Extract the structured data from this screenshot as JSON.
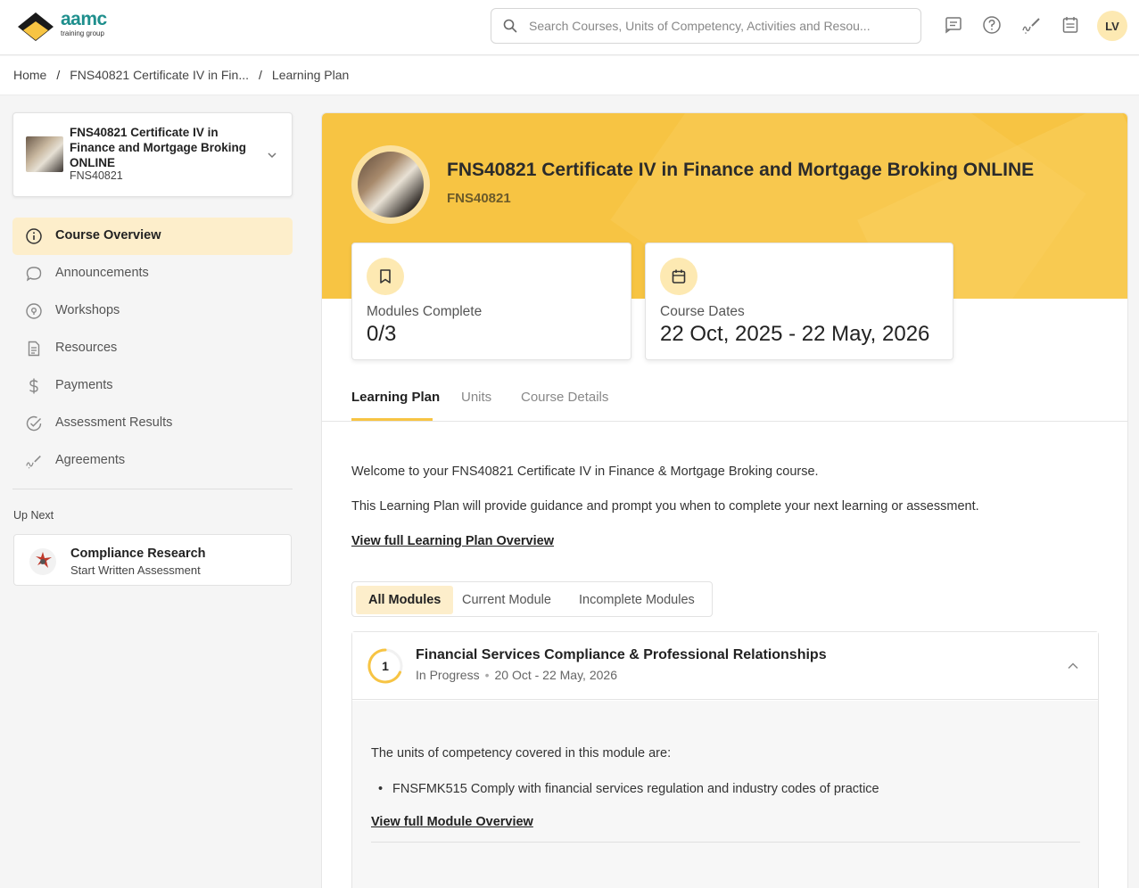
{
  "brand": {
    "name": "aamc",
    "tagline": "training group"
  },
  "search": {
    "placeholder": "Search Courses, Units of Competency, Activities and Resou..."
  },
  "header_icons": [
    "messages-icon",
    "help-icon",
    "agreements-icon",
    "calendar-icon"
  ],
  "user": {
    "initials": "LV"
  },
  "breadcrumb": {
    "home": "Home",
    "course": "FNS40821 Certificate IV in Fin...",
    "current": "Learning Plan"
  },
  "course_selector": {
    "title": "FNS40821 Certificate IV in Finance and Mortgage Broking ONLINE",
    "code": "FNS40821"
  },
  "sidebar": {
    "items": [
      {
        "label": "Course Overview",
        "icon": "info-icon",
        "active": true
      },
      {
        "label": "Announcements",
        "icon": "chat-bubble-icon",
        "active": false
      },
      {
        "label": "Workshops",
        "icon": "location-pin-icon",
        "active": false
      },
      {
        "label": "Resources",
        "icon": "document-icon",
        "active": false
      },
      {
        "label": "Payments",
        "icon": "dollar-icon",
        "active": false
      },
      {
        "label": "Assessment Results",
        "icon": "check-circle-icon",
        "active": false
      },
      {
        "label": "Agreements",
        "icon": "signature-icon",
        "active": false
      }
    ]
  },
  "up_next": {
    "heading": "Up Next",
    "title": "Compliance Research",
    "subtitle": "Start Written Assessment"
  },
  "hero": {
    "title": "FNS40821 Certificate IV in Finance and Mortgage Broking ONLINE",
    "code": "FNS40821",
    "color": "#f7c443"
  },
  "stats": {
    "modules": {
      "label": "Modules Complete",
      "value": "0/3"
    },
    "dates": {
      "label": "Course Dates",
      "value": "22 Oct, 2025 - 22 May, 2026"
    }
  },
  "tabs": [
    "Learning Plan",
    "Units",
    "Course Details"
  ],
  "content": {
    "welcome": "Welcome to your FNS40821 Certificate IV in Finance & Mortgage Broking course.",
    "guidance": "This Learning Plan will provide guidance and prompt you when to complete your next learning or assessment.",
    "overview_link": "View full Learning Plan Overview"
  },
  "filters": [
    "All Modules",
    "Current Module",
    "Incomplete Modules"
  ],
  "module": {
    "number": "1",
    "title": "Financial Services Compliance & Professional Relationships",
    "status": "In Progress",
    "dates": "20 Oct - 22 May, 2026",
    "intro": "The units of competency covered in this module are:",
    "units": [
      "FNSFMK515 Comply with financial services regulation and industry codes of practice"
    ],
    "overview_link": "View full Module Overview"
  }
}
